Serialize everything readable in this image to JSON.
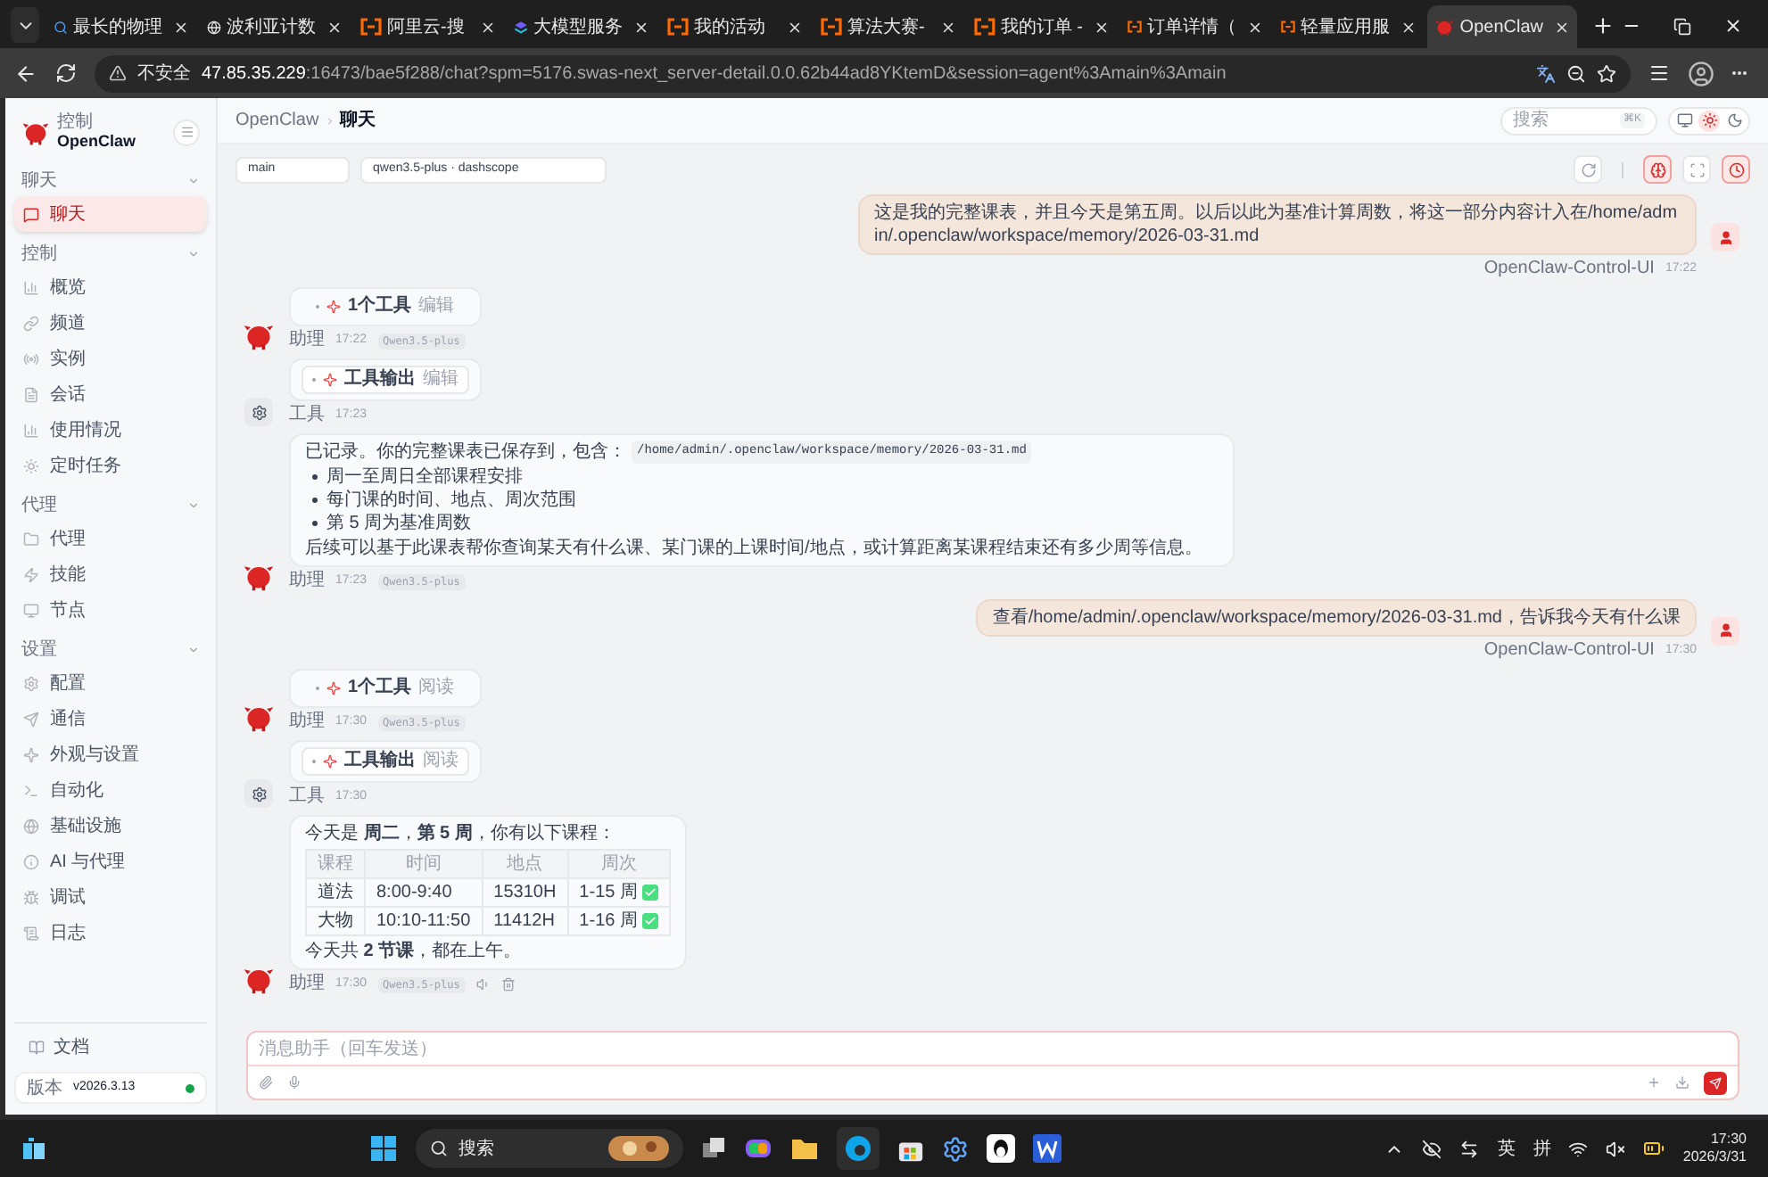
{
  "browser": {
    "tabs": [
      {
        "title": "最长的物理",
        "selected": false
      },
      {
        "title": "波利亚计数",
        "selected": false
      },
      {
        "title": "阿里云-搜",
        "selected": false
      },
      {
        "title": "大模型服务",
        "selected": false
      },
      {
        "title": "我的活动",
        "selected": false
      },
      {
        "title": "算法大赛-",
        "selected": false
      },
      {
        "title": "我的订单 -",
        "selected": false
      },
      {
        "title": "订单详情（",
        "selected": false
      },
      {
        "title": "轻量应用服",
        "selected": false
      },
      {
        "title": "OpenClaw",
        "selected": true
      }
    ],
    "security": "不安全",
    "host": "47.85.35.229",
    "path": ":16473/bae5f288/chat?spm=5176.swas-next_server-detail.0.0.62b44ad8YKtemD&session=agent%3Amain%3Amain"
  },
  "sidebar": {
    "brand": {
      "subtitle": "控制",
      "title": "OpenClaw"
    },
    "groups": [
      {
        "label": "聊天",
        "expanded": true,
        "items": [
          {
            "label": "聊天",
            "selected": true
          }
        ]
      },
      {
        "label": "控制",
        "expanded": true,
        "items": [
          {
            "label": "概览",
            "selected": false
          },
          {
            "label": "频道",
            "selected": false
          },
          {
            "label": "实例",
            "selected": false
          },
          {
            "label": "会话",
            "selected": false
          },
          {
            "label": "使用情况",
            "selected": false
          },
          {
            "label": "定时任务",
            "selected": false
          }
        ]
      },
      {
        "label": "代理",
        "expanded": true,
        "items": [
          {
            "label": "代理",
            "selected": false
          },
          {
            "label": "技能",
            "selected": false
          },
          {
            "label": "节点",
            "selected": false
          }
        ]
      },
      {
        "label": "设置",
        "expanded": true,
        "items": [
          {
            "label": "配置",
            "selected": false
          },
          {
            "label": "通信",
            "selected": false
          },
          {
            "label": "外观与设置",
            "selected": false
          },
          {
            "label": "自动化",
            "selected": false
          },
          {
            "label": "基础设施",
            "selected": false
          },
          {
            "label": "AI 与代理",
            "selected": false
          },
          {
            "label": "调试",
            "selected": false
          },
          {
            "label": "日志",
            "selected": false
          }
        ]
      }
    ],
    "docs": "文档",
    "version": {
      "label": "版本",
      "value": "v2026.3.13",
      "online": true
    }
  },
  "topbar": {
    "breadcrumb": [
      "OpenClaw",
      "聊天"
    ],
    "search": {
      "placeholder": "搜索",
      "shortcut": "⌘K"
    },
    "theme_modes": [
      {
        "selected": false
      },
      {
        "selected": true
      },
      {
        "selected": false
      }
    ]
  },
  "chat_toolbar": {
    "agent": "main",
    "model": "qwen3.5-plus · dashscope",
    "buttons": [
      {
        "kind": "refresh",
        "selected": false
      },
      {
        "kind": "thinking",
        "selected": true
      },
      {
        "kind": "focus",
        "selected": false
      },
      {
        "kind": "cron",
        "selected": true
      }
    ]
  },
  "messages": [
    {
      "kind": "user",
      "text": "这是我的完整课表，并且今天是第五周。以后以此为基准计算周数，将这一部分内容计入在/home/admin/.openclaw/workspace/memory/2026-03-31.md",
      "sender": "OpenClaw-Control-UI",
      "time": "17:22"
    },
    {
      "kind": "tool_call",
      "title": "1个工具",
      "action": "编辑",
      "sender": "助理",
      "time": "17:22",
      "model": "Qwen3.5-plus"
    },
    {
      "kind": "tool_output",
      "title": "工具输出",
      "action": "编辑",
      "sender": "工具",
      "time": "17:23"
    },
    {
      "kind": "assistant_text",
      "intro": "已记录。你的完整课表已保存到，包含：",
      "code": "/home/admin/.openclaw/workspace/memory/2026-03-31.md",
      "bullets": [
        "周一至周日全部课程安排",
        "每门课的时间、地点、周次范围",
        "第 5 周为基准周数"
      ],
      "outro": "后续可以基于此课表帮你查询某天有什么课、某门课的上课时间/地点，或计算距离某课程结束还有多少周等信息。",
      "sender": "助理",
      "time": "17:23",
      "model": "Qwen3.5-plus"
    },
    {
      "kind": "user",
      "text": "查看/home/admin/.openclaw/workspace/memory/2026-03-31.md，告诉我今天有什么课",
      "sender": "OpenClaw-Control-UI",
      "time": "17:30"
    },
    {
      "kind": "tool_call",
      "title": "1个工具",
      "action": "阅读",
      "sender": "助理",
      "time": "17:30",
      "model": "Qwen3.5-plus"
    },
    {
      "kind": "tool_output",
      "title": "工具输出",
      "action": "阅读",
      "sender": "工具",
      "time": "17:30"
    },
    {
      "kind": "assistant_table",
      "intro": "今天是 **周二**，**第 5 周**，你有以下课程：",
      "columns": [
        "课程",
        "时间",
        "地点",
        "周次"
      ],
      "rows": [
        {
          "cells": [
            "道法",
            "8:00-9:40",
            "15310H",
            "1-15 周"
          ],
          "checked": true
        },
        {
          "cells": [
            "大物",
            "10:10-11:50",
            "11412H",
            "1-16 周"
          ],
          "checked": true
        }
      ],
      "outro": "今天共 **2 节课**，都在上午。",
      "sender": "助理",
      "time": "17:30",
      "model": "Qwen3.5-plus",
      "actions": true
    }
  ],
  "composer": {
    "placeholder": "消息助手（回车发送）"
  },
  "taskbar": {
    "search": "搜索",
    "ime_lang": "英",
    "ime_mode": "拼",
    "time": "17:30",
    "date": "2026/3/31"
  }
}
